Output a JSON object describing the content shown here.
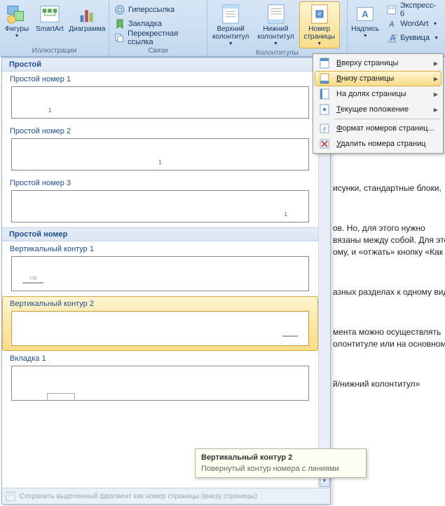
{
  "ribbon": {
    "groups": {
      "illustrations": {
        "label": "Иллюстрации",
        "shapes": "Фигуры",
        "smartart": "SmartArt",
        "chart": "Диаграмма"
      },
      "links": {
        "label": "Связи",
        "hyperlink": "Гиперссылка",
        "bookmark": "Закладка",
        "crossref": "Перекрестная ссылка"
      },
      "headers": {
        "label": "Колонтитулы",
        "header": "Верхний\nколонтитул",
        "footer": "Нижний\nколонтитул",
        "pagenum": "Номер\nстраницы"
      },
      "text": {
        "textbox": "Надпись",
        "quickparts": "Экспресс-б",
        "wordart": "WordArt",
        "dropcap": "Буквица"
      }
    }
  },
  "menu": {
    "top": "Вверху страницы",
    "bottom": "Внизу страницы",
    "margins": "На долях страницы",
    "current": "Текущее положение",
    "format": "Формат номеров страниц...",
    "remove": "Удалить номера страниц"
  },
  "gallery": {
    "cat_simple": "Простой",
    "cat_simple_num": "Простой номер",
    "opts": [
      {
        "title": "Простой номер 1",
        "kind": "num-left"
      },
      {
        "title": "Простой номер 2",
        "kind": "num-center"
      },
      {
        "title": "Простой номер 3",
        "kind": "num-right"
      },
      {
        "title": "Вертикальный контур 1",
        "kind": "vert-1"
      },
      {
        "title": "Вертикальный контур 2",
        "kind": "vert-2"
      },
      {
        "title": "Вкладка 1",
        "kind": "tab-1"
      }
    ],
    "footer": "Сохранить выделенный фрагмент как номер страницы (внизу страницы)"
  },
  "tooltip": {
    "title": "Вертикальный контур 2",
    "body": "Повернутый контур номера с линиями"
  },
  "doc": {
    "p1": "исунки, стандартные блоки,",
    "p2": "ов. Но, для этого нужно\nвязаны между собой. Для этого\nому, и «отжать» кнопку «Как в",
    "p3": "азных разделах к одному виду,",
    "p4": "мента можно осуществлять\nолонтитуле или на основном",
    "p5": "й/нижний колонтитул»"
  }
}
